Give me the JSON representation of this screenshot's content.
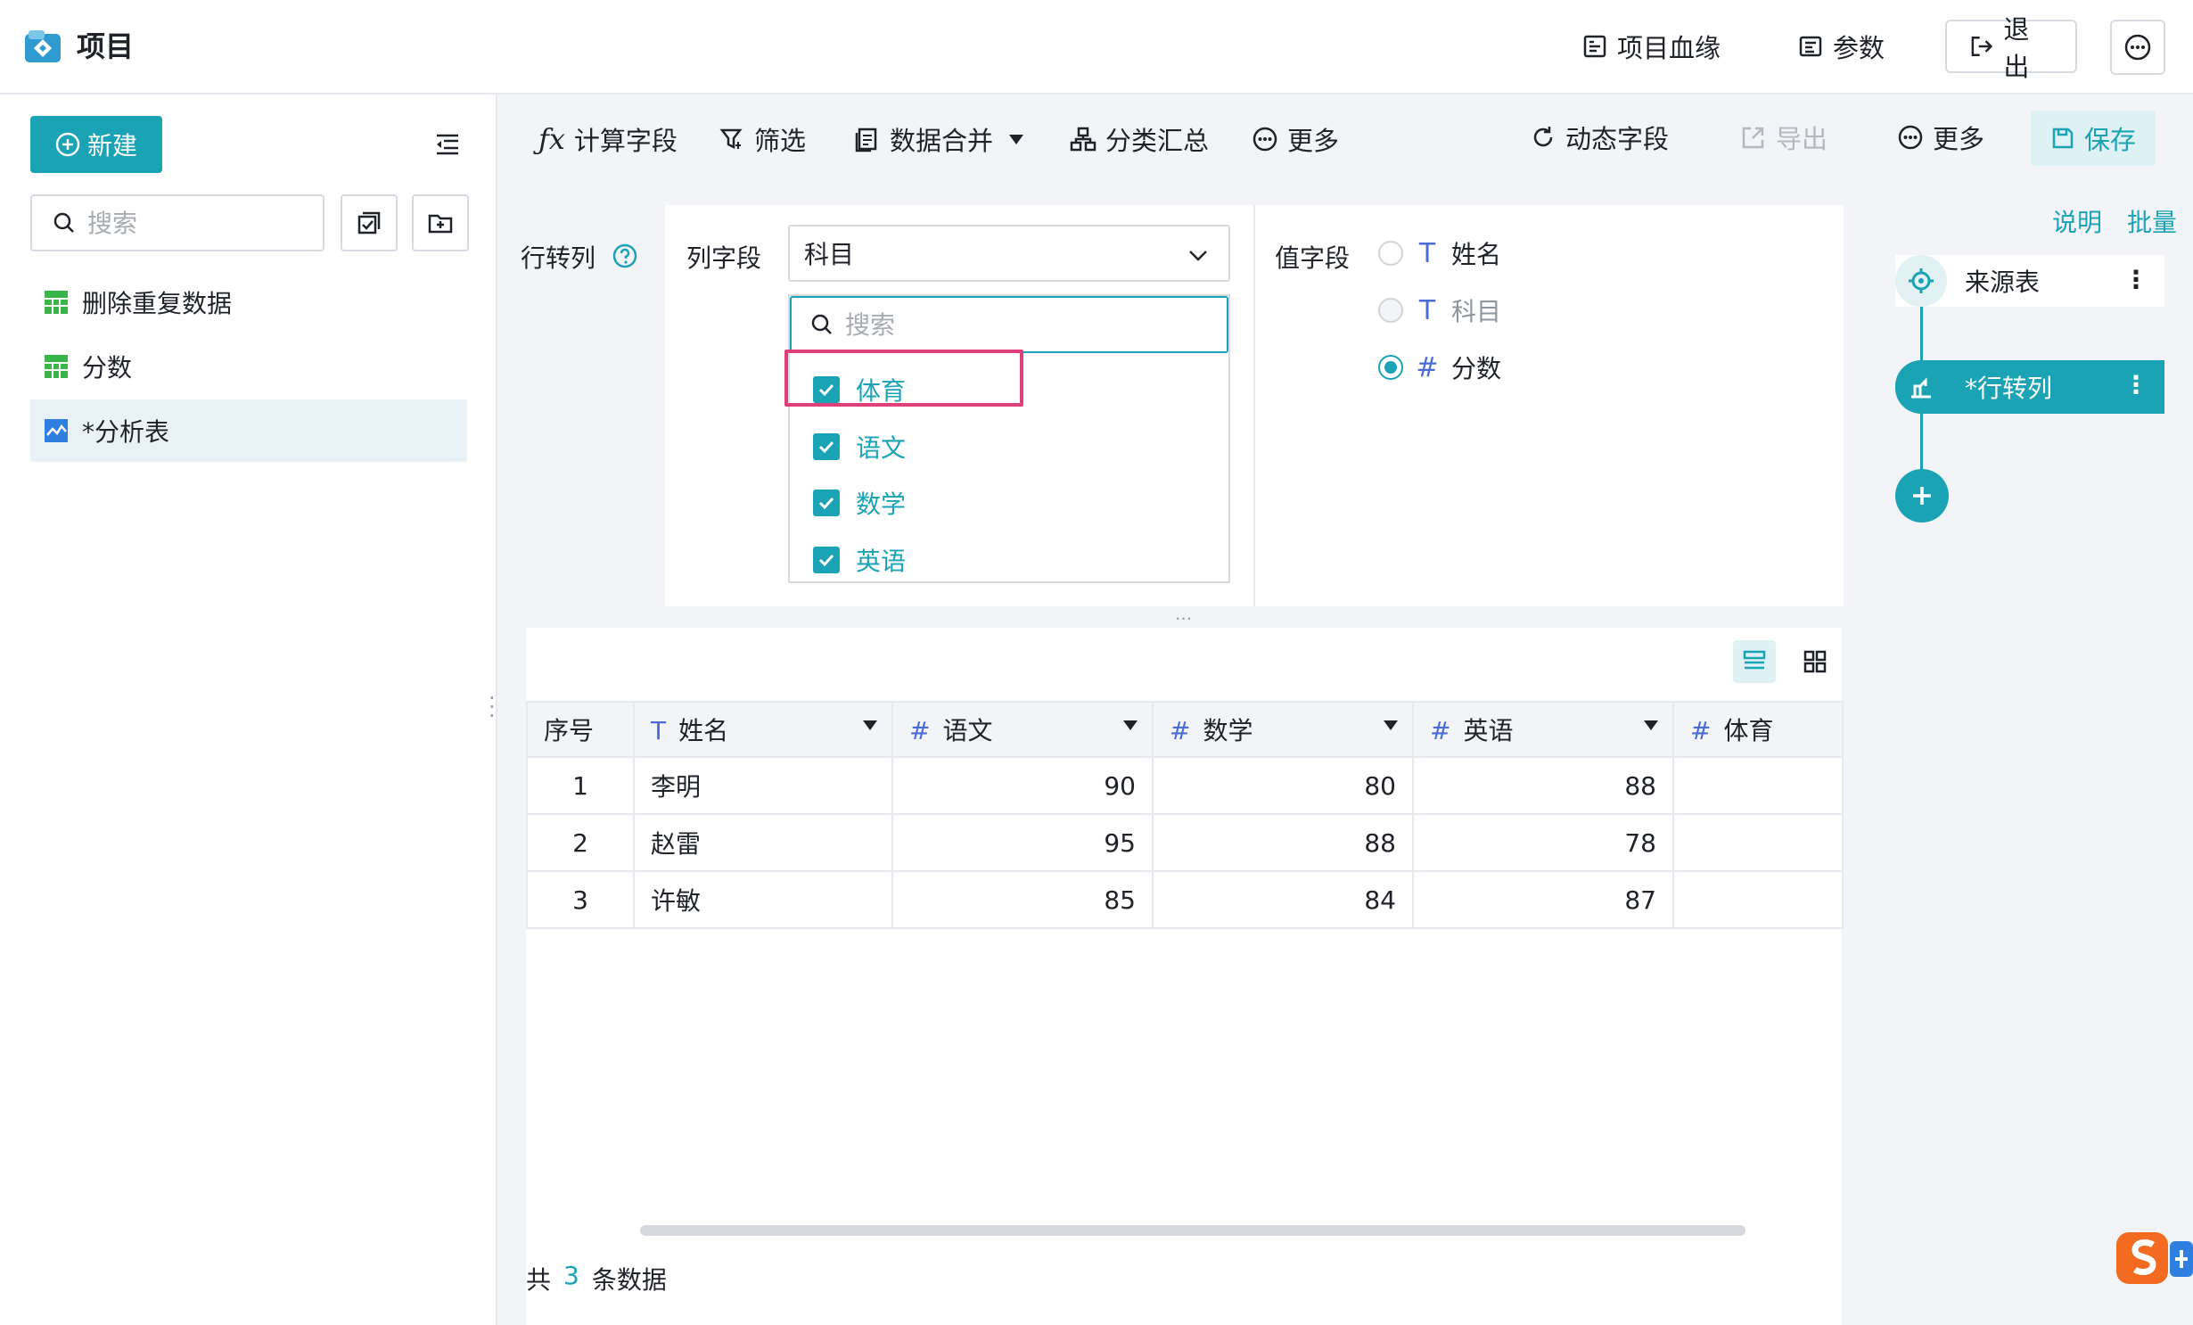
{
  "app": {
    "title": "项目"
  },
  "header": {
    "lineage_label": "项目血缘",
    "params_label": "参数",
    "exit_label": "退出"
  },
  "sidebar": {
    "new_label": "新建",
    "search_placeholder": "搜索",
    "items": [
      {
        "label": "删除重复数据",
        "icon": "table-icon"
      },
      {
        "label": "分数",
        "icon": "table-icon"
      },
      {
        "label": "*分析表",
        "icon": "chart-icon",
        "active": true
      }
    ]
  },
  "toolbar": {
    "calc_field": "计算字段",
    "filter": "筛选",
    "merge": "数据合并",
    "group_summary": "分类汇总",
    "more1": "更多",
    "dynamic_field": "动态字段",
    "export": "导出",
    "more2": "更多",
    "save": "保存"
  },
  "config": {
    "section_label": "行转列",
    "column_field_label": "列字段",
    "column_field_value": "科目",
    "dropdown_search_placeholder": "搜索",
    "dropdown_options": [
      {
        "label": "体育",
        "checked": true
      },
      {
        "label": "语文",
        "checked": true
      },
      {
        "label": "数学",
        "checked": true
      },
      {
        "label": "英语",
        "checked": true
      }
    ],
    "value_field_label": "值字段",
    "value_fields": [
      {
        "type": "T",
        "label": "姓名",
        "state": "unchecked"
      },
      {
        "type": "T",
        "label": "科目",
        "state": "disabled"
      },
      {
        "type": "#",
        "label": "分数",
        "state": "checked"
      }
    ]
  },
  "table": {
    "columns": [
      {
        "label": "序号",
        "type": ""
      },
      {
        "label": "姓名",
        "type": "T"
      },
      {
        "label": "语文",
        "type": "#"
      },
      {
        "label": "数学",
        "type": "#"
      },
      {
        "label": "英语",
        "type": "#"
      },
      {
        "label": "体育",
        "type": "#"
      }
    ],
    "rows": [
      [
        "1",
        "李明",
        "90",
        "80",
        "88",
        ""
      ],
      [
        "2",
        "赵雷",
        "95",
        "88",
        "78",
        ""
      ],
      [
        "3",
        "许敏",
        "85",
        "84",
        "87",
        ""
      ]
    ]
  },
  "footer": {
    "prefix": "共",
    "count": "3",
    "suffix": "条数据"
  },
  "right_panel": {
    "explain_link": "说明",
    "batch_link": "批量",
    "steps": [
      {
        "label": "来源表"
      },
      {
        "label": "*行转列"
      }
    ]
  },
  "colors": {
    "accent": "#1aa3b5",
    "highlight": "#e0407a",
    "field_type": "#4a6bd4"
  }
}
